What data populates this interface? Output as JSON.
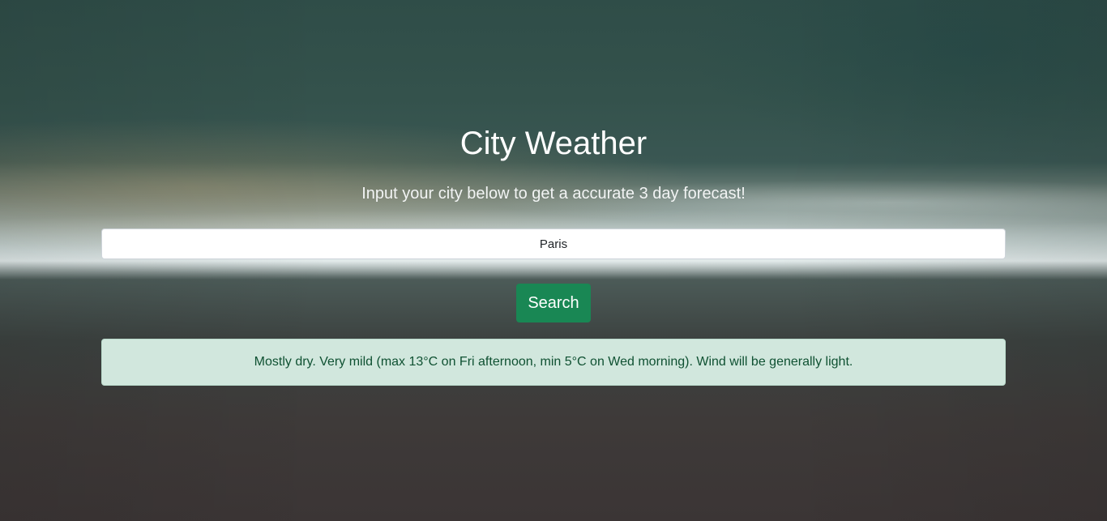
{
  "header": {
    "title": "City Weather",
    "subtitle": "Input your city below to get a accurate 3 day forecast!"
  },
  "search": {
    "value": "Paris",
    "placeholder": "",
    "button_label": "Search"
  },
  "forecast": {
    "text": "Mostly dry. Very mild (max 13°C on Fri afternoon, min 5°C on Wed morning). Wind will be generally light."
  },
  "colors": {
    "button": "#198754",
    "alert_background": "#d1e7dd",
    "alert_text": "#0f5132"
  }
}
